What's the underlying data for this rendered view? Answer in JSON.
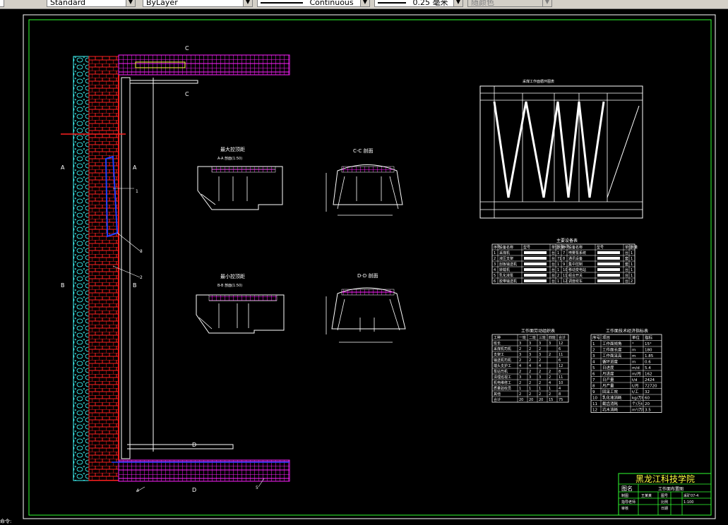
{
  "toolbar": {
    "text_style": "Standard",
    "layer": "ByLayer",
    "linetype": "Continuous",
    "lineweight": "0.25 毫米",
    "plot_style": "随颜色"
  },
  "drawing": {
    "section_labels": {
      "c": "C",
      "a": "A",
      "b": "B",
      "d": "D"
    },
    "callouts": [
      "1",
      "2",
      "3",
      "4",
      "5"
    ],
    "views": {
      "max_roof_title": "最大控顶距",
      "max_roof_sub": "A-A 剖面(1:50)",
      "min_roof_title": "最小控顶距",
      "min_roof_sub": "B-B 剖面(1:50)",
      "cc_title": "C-C 剖面",
      "dd_title": "D-D 剖面"
    },
    "cycle_table_title": "采煤工作面循环图表",
    "equipment": {
      "title": "主要设备表",
      "headers": [
        "序号",
        "设备名称",
        "型号",
        "单位",
        "数量",
        "序号",
        "设备名称",
        "型号",
        "单位",
        "数量"
      ],
      "rows": [
        [
          "1",
          "采煤机",
          "",
          "台",
          "1",
          "7",
          "喷雾泵系统",
          "",
          "台",
          "1"
        ],
        [
          "2",
          "液压支架",
          "",
          "台",
          "71",
          "8",
          "通讯设备",
          "",
          "套",
          "1"
        ],
        [
          "3",
          "刮板输送机",
          "",
          "台",
          "1",
          "9",
          "集中控制",
          "",
          "套",
          "1"
        ],
        [
          "4",
          "转载机",
          "",
          "台",
          "1",
          "10",
          "移动变电站",
          "",
          "台",
          "1"
        ],
        [
          "5",
          "乳化液泵",
          "",
          "台",
          "2",
          "11",
          "组合开关",
          "",
          "台",
          "1"
        ],
        [
          "6",
          "胶带输送机",
          "",
          "台",
          "1",
          "12",
          "调度绞车",
          "",
          "台",
          "2"
        ]
      ]
    },
    "labor": {
      "title": "工作面劳动组织表",
      "headers": [
        "工种",
        "一班",
        "二班",
        "三班",
        "四班",
        "合计"
      ],
      "rows": [
        [
          "班长",
          "3",
          "3",
          "3",
          "3",
          "12"
        ],
        [
          "采煤机司机",
          "2",
          "2",
          "2",
          "",
          "6"
        ],
        [
          "支架工",
          "3",
          "3",
          "3",
          "2",
          "11"
        ],
        [
          "输送机司机",
          "2",
          "2",
          "2",
          "",
          "6"
        ],
        [
          "端头支护工",
          "4",
          "4",
          "4",
          "",
          "12"
        ],
        [
          "泵站司机",
          "2",
          "2",
          "2",
          "2",
          "8"
        ],
        [
          "清理巡视工",
          "3",
          "3",
          "3",
          "2",
          "11"
        ],
        [
          "机电维修工",
          "2",
          "2",
          "2",
          "4",
          "10"
        ],
        [
          "质量验收员",
          "1",
          "1",
          "1",
          "1",
          "4"
        ],
        [
          "其他",
          "2",
          "2",
          "2",
          "2",
          "8"
        ],
        [
          "合计",
          "20",
          "20",
          "20",
          "15",
          "75"
        ]
      ]
    },
    "tech": {
      "title": "工作面技术经济指标表",
      "headers": [
        "序号",
        "项目",
        "单位",
        "指标"
      ],
      "rows": [
        [
          "1",
          "工作面倾角",
          "°",
          "15°"
        ],
        [
          "2",
          "工作面长度",
          "m",
          "180"
        ],
        [
          "3",
          "工作面采高",
          "m",
          "1.85"
        ],
        [
          "4",
          "循环进度",
          "m",
          "0.6"
        ],
        [
          "5",
          "日进度",
          "m/d",
          "5.4"
        ],
        [
          "6",
          "月进度",
          "m/月",
          "162"
        ],
        [
          "7",
          "日产量",
          "t/d",
          "2424"
        ],
        [
          "8",
          "月产量",
          "t/月",
          "72720"
        ],
        [
          "9",
          "回采工效",
          "t/工",
          "32"
        ],
        [
          "10",
          "乳化液消耗",
          "kg/万t",
          "60"
        ],
        [
          "11",
          "截齿消耗",
          "个/万t",
          "20"
        ],
        [
          "12",
          "坑木消耗",
          "m³/万t",
          "3.5"
        ]
      ]
    },
    "title_block": {
      "school": "黑龙江科技学院",
      "drawing_label": "图名",
      "drawing_name": "工作面布置图",
      "r1": [
        "制图",
        "王某某",
        "图号",
        "采矿07-4"
      ],
      "r2": [
        "指导老师",
        "",
        "比例",
        "1:100"
      ],
      "r3": [
        "审核",
        "",
        "日期",
        ""
      ]
    },
    "status": "命令:"
  }
}
